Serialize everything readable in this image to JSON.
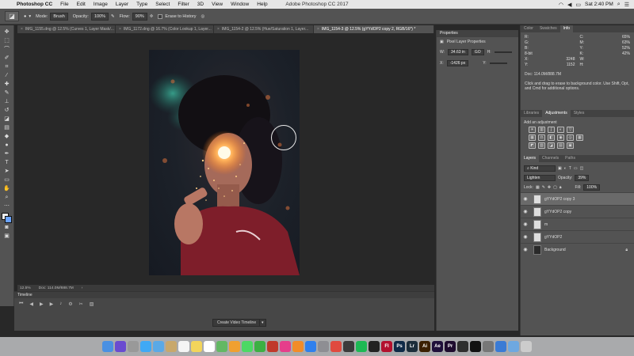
{
  "menubar": {
    "app_name": "Photoshop CC",
    "items": [
      "File",
      "Edit",
      "Image",
      "Layer",
      "Type",
      "Select",
      "Filter",
      "3D",
      "View",
      "Window",
      "Help"
    ],
    "window_title": "Adobe Photoshop CC 2017",
    "clock": "Sat 2:40 PM"
  },
  "options": {
    "mode_label": "Mode:",
    "mode_value": "Brush",
    "opacity_label": "Opacity:",
    "opacity_value": "100%",
    "flow_label": "Flow:",
    "flow_value": "90%",
    "erase_history_label": "Erase to History"
  },
  "tabs": [
    "IMG_1155.dng @ 12.5% (Curves 1, Layer Mask/...",
    "IMG_1172.dng @ 16.7% (Color Lookup 1, Layer...",
    "IMG_1154-2 @ 12.5% (Hue/Saturation 1, Layer...",
    "IMG_1154-3 @ 12.5% (gYYdOP2 copy 2, RGB/16*) *"
  ],
  "status": {
    "zoom": "12.5%",
    "doc": "Doc: 114.0M/888.7M"
  },
  "timeline": {
    "title": "Timeline",
    "create_button": "Create Video Timeline"
  },
  "properties": {
    "tab": "Properties",
    "header": "Pixel Layer Properties",
    "w_label": "W:",
    "w_value": "34.63 in",
    "go_label": "GO",
    "h_label": "H:",
    "x_label": "X:",
    "x_value": "-1426 px",
    "y_label": "Y:"
  },
  "info_panel": {
    "tabs": [
      "Color",
      "Swatches",
      "Info"
    ],
    "left": [
      [
        "R:",
        ""
      ],
      [
        "G:",
        ""
      ],
      [
        "B:",
        ""
      ],
      [
        "8-bit",
        ""
      ],
      [
        "X:",
        "3248"
      ],
      [
        "Y:",
        "1152"
      ]
    ],
    "right": [
      [
        "C:",
        "65%"
      ],
      [
        "M:",
        "63%"
      ],
      [
        "Y:",
        "52%"
      ],
      [
        "K:",
        "42%"
      ],
      [
        "W:",
        ""
      ],
      [
        "H:",
        ""
      ]
    ],
    "doc": "Doc: 114.0M/888.7M",
    "message": "Click and drag to erase to background color. Use Shift, Opt, and Cmd for additional options."
  },
  "libraries": {
    "tabs": [
      "Libraries",
      "Adjustments",
      "Styles"
    ],
    "add_label": "Add an adjustment"
  },
  "layers_panel": {
    "tabs": [
      "Layers",
      "Channels",
      "Paths"
    ],
    "kind_label": "Kind",
    "blend_mode": "Lighten",
    "opacity_label": "Opacity:",
    "opacity_value": "39%",
    "lock_label": "Lock:",
    "fill_label": "Fill:",
    "fill_value": "100%",
    "layers": [
      {
        "name": "gYYdOP2 copy 3",
        "active": true,
        "thumb": "white"
      },
      {
        "name": "gYYdOP2 copy",
        "active": false,
        "thumb": "white"
      },
      {
        "name": "m",
        "active": false,
        "thumb": "white"
      },
      {
        "name": "gYYdOP2",
        "active": false,
        "thumb": "white"
      },
      {
        "name": "Background",
        "active": false,
        "thumb": "dark",
        "locked": true
      }
    ]
  },
  "dock_apps": [
    {
      "name": "finder",
      "color": "#4a90e2"
    },
    {
      "name": "siri",
      "color": "#6a4bd0"
    },
    {
      "name": "launchpad",
      "color": "#999999"
    },
    {
      "name": "safari",
      "color": "#3fa9f5"
    },
    {
      "name": "mail",
      "color": "#5aa9e6"
    },
    {
      "name": "contacts",
      "color": "#c8a86b"
    },
    {
      "name": "calendar",
      "color": "#f5f5f5"
    },
    {
      "name": "notes",
      "color": "#f3d55b"
    },
    {
      "name": "reminders",
      "color": "#ffffff"
    },
    {
      "name": "maps",
      "color": "#63b863"
    },
    {
      "name": "photos",
      "color": "#f0a030"
    },
    {
      "name": "messages",
      "color": "#4cd964"
    },
    {
      "name": "facetime",
      "color": "#3cb043"
    },
    {
      "name": "photobooth",
      "color": "#c0392b"
    },
    {
      "name": "itunes",
      "color": "#e63e8b"
    },
    {
      "name": "ibooks",
      "color": "#f28c28"
    },
    {
      "name": "appstore",
      "color": "#2f80ed"
    },
    {
      "name": "preferences",
      "color": "#8e8e93"
    },
    {
      "name": "chrome",
      "color": "#e04a3f"
    },
    {
      "name": "resolve",
      "color": "#3b3b3b"
    },
    {
      "name": "spotify",
      "color": "#1db954"
    },
    {
      "name": "final-cut",
      "color": "#222222"
    },
    {
      "name": "flash",
      "color": "#b3112e"
    },
    {
      "name": "photoshop",
      "color": "#0e2a47"
    },
    {
      "name": "lightroom",
      "color": "#1b2d3a"
    },
    {
      "name": "illustrator",
      "color": "#3a1f00"
    },
    {
      "name": "after-effects",
      "color": "#1f0f3a"
    },
    {
      "name": "premiere",
      "color": "#1e0b2e"
    },
    {
      "name": "app-1",
      "color": "#2e2e2e"
    },
    {
      "name": "terminal",
      "color": "#111111"
    },
    {
      "name": "app-2",
      "color": "#777777"
    },
    {
      "name": "bluetooth",
      "color": "#3a7bd5"
    },
    {
      "name": "downloads",
      "color": "#6ea8e0"
    },
    {
      "name": "trash",
      "color": "#cccccc"
    }
  ],
  "dock_labels": {
    "photoshop": "Ps",
    "lightroom": "Lr",
    "illustrator": "Ai",
    "after-effects": "Ae",
    "premiere": "Pr",
    "flash": "Fl"
  }
}
